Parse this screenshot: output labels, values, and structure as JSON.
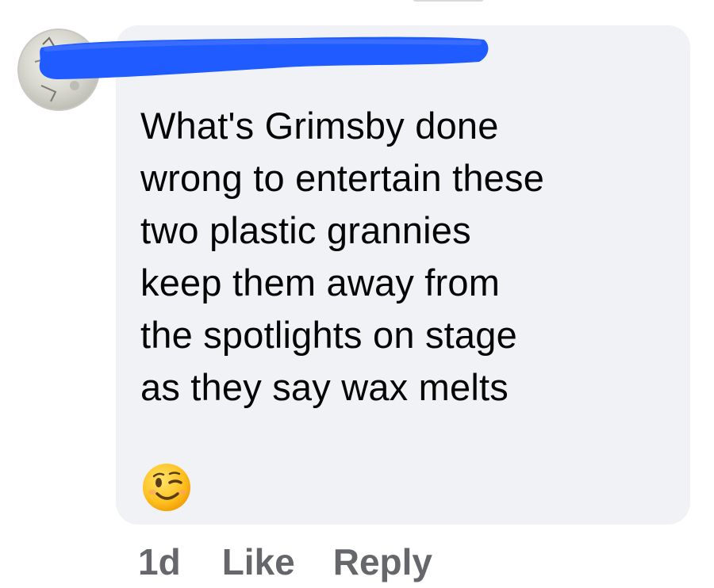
{
  "comment": {
    "author_name": "",
    "text_lines": [
      "What's Grimsby done",
      "wrong to entertain these",
      "two plastic grannies",
      "keep them away from",
      "the spotlights on stage",
      "as they say wax melts"
    ],
    "emoji": "winking-face-emoji",
    "redaction_color": "#1f5bff",
    "bubble_color": "#f0f2f5"
  },
  "actions": {
    "timestamp": "1d",
    "like_label": "Like",
    "reply_label": "Reply"
  }
}
